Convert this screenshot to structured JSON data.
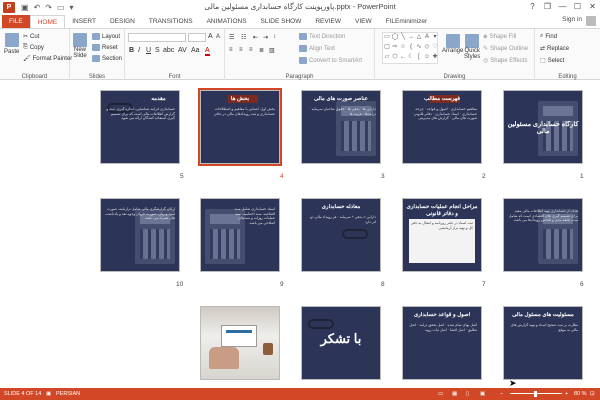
{
  "window": {
    "title": "پاورپوینت کارگاه حسابداری مسئولین مالی.pptx - PowerPoint",
    "app_icon": "P",
    "qat": [
      "save-icon",
      "undo-icon",
      "redo-icon",
      "slideshow-icon",
      "customize-icon"
    ],
    "controls": [
      "?",
      "❐",
      "—",
      "☐",
      "✕"
    ]
  },
  "tabs": [
    "FILE",
    "HOME",
    "INSERT",
    "DESIGN",
    "TRANSITIONS",
    "ANIMATIONS",
    "SLIDE SHOW",
    "REVIEW",
    "VIEW",
    "FILEminimizer"
  ],
  "active_tab": "HOME",
  "signin": "Sign in",
  "ribbon": {
    "clipboard": {
      "label": "Clipboard",
      "paste": "Paste",
      "cut": "Cut",
      "copy": "Copy",
      "format_painter": "Format Painter"
    },
    "slides": {
      "label": "Slides",
      "new_slide": "New",
      "new_slide2": "Slide",
      "layout": "Layout",
      "reset": "Reset",
      "section": "Section"
    },
    "font": {
      "label": "Font",
      "bold": "B",
      "italic": "I",
      "underline": "U",
      "strike": "S",
      "shadow": "abc",
      "spacing": "AV",
      "case": "Aa",
      "color": "A",
      "grow": "A",
      "shrink": "A"
    },
    "paragraph": {
      "label": "Paragraph",
      "text_direction": "Text Direction",
      "align_text": "Align Text",
      "smartart": "Convert to SmartArt"
    },
    "drawing": {
      "label": "Drawing",
      "arrange": "Arrange",
      "quick_styles": "Quick",
      "quick_styles2": "Styles",
      "shape_fill": "Shape Fill",
      "shape_outline": "Shape Outline",
      "shape_effects": "Shape Effects"
    },
    "editing": {
      "label": "Editing",
      "find": "Find",
      "replace": "Replace",
      "select": "Select"
    }
  },
  "slides": [
    {
      "n": "1",
      "title": "کارگاه حسابداری مسئولین مالی",
      "body": "",
      "kind": "title"
    },
    {
      "n": "2",
      "title": "فهرست مطالب",
      "body": "مفاهیم حسابداری · اصول و قواعد · چرخه حسابداری · اسناد حسابداری · دفاتر قانونی · صورت های مالی · گزارش های مدیریتی",
      "kind": "list"
    },
    {
      "n": "3",
      "title": "عناصر صورت های مالی",
      "body": "دارایی ها · بدهی ها · حقوق صاحبان سرمایه · درآمدها · هزینه ها",
      "kind": "list"
    },
    {
      "n": "4",
      "title": "بحش ها",
      "body": "بخش اول: آشنایی با مفاهیم و اصطلاحات حسابداری و ثبت رویدادهای مالی در دفاتر",
      "kind": "list",
      "selected": true
    },
    {
      "n": "5",
      "title": "مقدمه",
      "body": "حسابداری فرآیند شناسایی، اندازه گیری، ثبت و گزارش اطلاعات مالی است که برای تصمیم گیری استفاده کنندگان ارائه می شود.",
      "kind": "list"
    },
    {
      "n": "6",
      "title": "",
      "body": "هدف از حسابداری تهیه اطلاعات مالی مفید برای تصمیم گیری های اقتصادی است که شامل ثبت، طبقه بندی و تلخیص رویدادها می باشد.",
      "kind": "text"
    },
    {
      "n": "7",
      "title": "مراحل انجام عملیات حسابداری و دفاتر قانونی",
      "body": "ثبت اسناد در دفتر روزنامه و انتقال به دفتر کل و تهیه تراز آزمایشی",
      "kind": "doc"
    },
    {
      "n": "8",
      "title": "معادله حسابداری",
      "body": "دارایی = بدهی + سرمایه · هر رویداد مالی دو اثر دارد",
      "kind": "list"
    },
    {
      "n": "9",
      "title": "",
      "body": "اسناد حسابداری شامل سند افتتاحیه، سند اختتامیه، سند عملیات روزانه و سندهای اصلاحی می باشد.",
      "kind": "list"
    },
    {
      "n": "10",
      "title": "",
      "body": "ارکان گزارشگری مالی شامل ترازنامه، صورت سود و زیان، صورت جریان وجوه نقد و یادداشت های همراه می باشد.",
      "kind": "list"
    },
    {
      "n": "11",
      "title": "مسئولیت های مسئول مالی",
      "body": "نظارت بر ثبت صحیح اسناد و تهیه گزارش های مالی به موقع",
      "kind": "text"
    },
    {
      "n": "12",
      "title": "اصول و قواعد حسابداری",
      "body": "اصل بهای تمام شده · اصل تحقق درآمد · اصل تطابق · اصل افشا · اصل ثبات رویه",
      "kind": "text"
    },
    {
      "n": "13",
      "title": "با تشکر",
      "body": "",
      "kind": "thanks"
    },
    {
      "n": "14",
      "title": "",
      "body": "",
      "kind": "photo"
    }
  ],
  "status": {
    "slide_of": "SLIDE 4 OF 14",
    "language": "PERSIAN",
    "zoom": "80 %"
  }
}
